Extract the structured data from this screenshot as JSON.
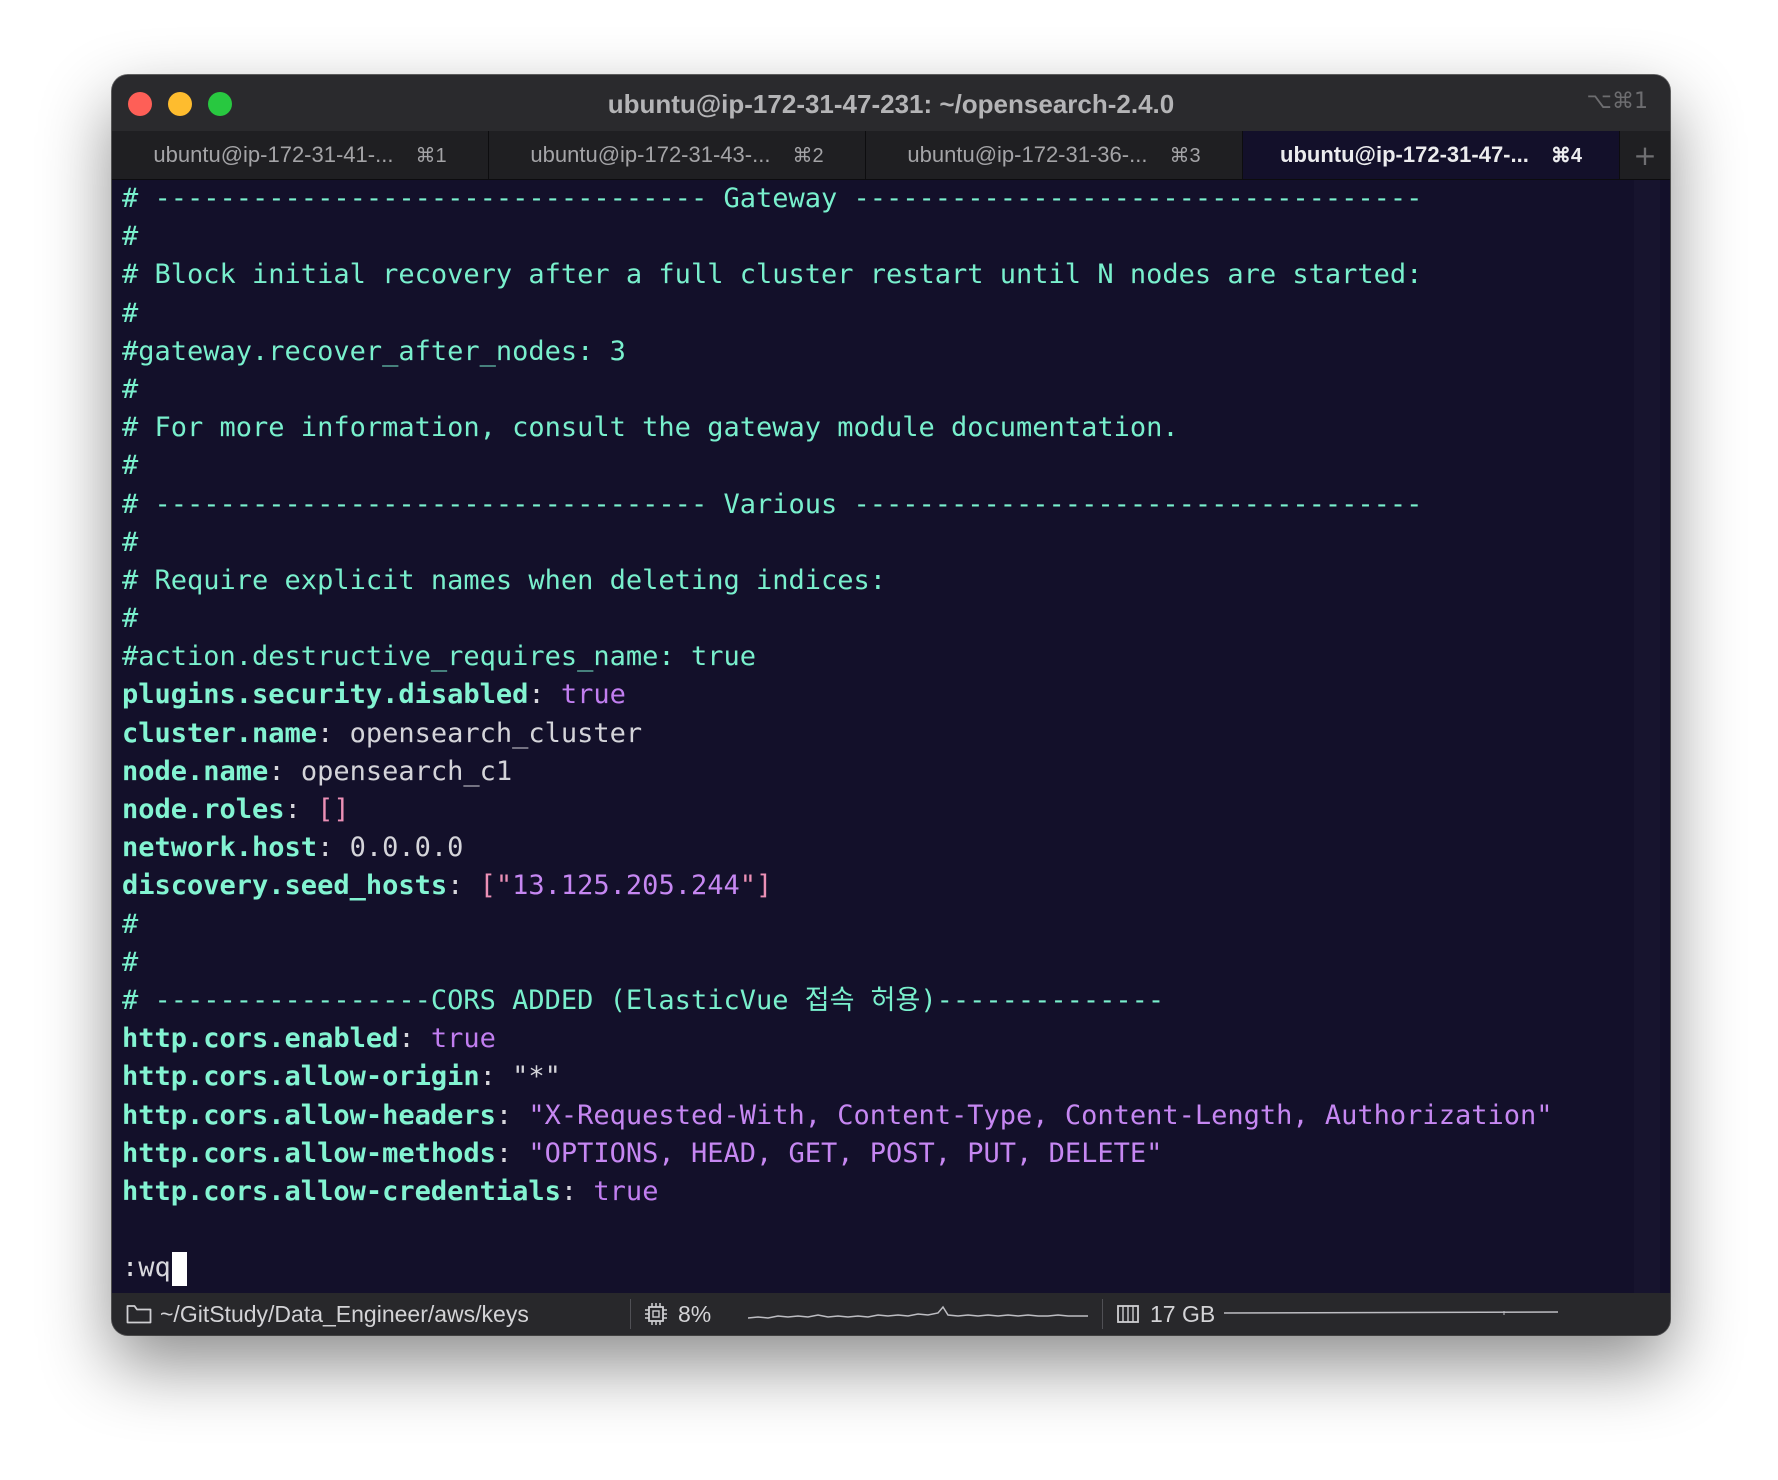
{
  "window": {
    "title": "ubuntu@ip-172-31-47-231: ~/opensearch-2.4.0",
    "shortcut": "⌥⌘1"
  },
  "tabs": [
    {
      "label": "ubuntu@ip-172-31-41-...",
      "key": "⌘1",
      "active": false
    },
    {
      "label": "ubuntu@ip-172-31-43-...",
      "key": "⌘2",
      "active": false
    },
    {
      "label": "ubuntu@ip-172-31-36-...",
      "key": "⌘3",
      "active": false
    },
    {
      "label": "ubuntu@ip-172-31-47-...",
      "key": "⌘4",
      "active": true
    }
  ],
  "tab_add_label": "+",
  "terminal": {
    "comments": {
      "gateway_header": "# ---------------------------------- Gateway -----------------------------------",
      "hash": "#",
      "block_recovery": "# Block initial recovery after a full cluster restart until N nodes are started:",
      "recover_after": "#gateway.recover_after_nodes: 3",
      "more_info": "# For more information, consult the gateway module documentation.",
      "various_header": "# ---------------------------------- Various -----------------------------------",
      "require_names": "# Require explicit names when deleting indices:",
      "destructive": "#action.destructive_requires_name: true",
      "cors_header": "# -----------------CORS ADDED (ElasticVue 접속 허용)--------------"
    },
    "config": {
      "security_key": "plugins.security.disabled",
      "security_val": "true",
      "cluster_key": "cluster.name",
      "cluster_val": "opensearch_cluster",
      "node_name_key": "node.name",
      "node_name_val": "opensearch_c1",
      "node_roles_key": "node.roles",
      "node_roles_val": "[]",
      "network_key": "network.host",
      "network_val": "0.0.0.0",
      "seed_key": "discovery.seed_hosts",
      "seed_open": "[\"",
      "seed_val": "13.125.205.244",
      "seed_close": "\"]",
      "cors_enabled_key": "http.cors.enabled",
      "cors_enabled_val": "true",
      "cors_origin_key": "http.cors.allow-origin",
      "cors_origin_val": "\"*\"",
      "cors_headers_key": "http.cors.allow-headers",
      "cors_headers_val": "\"X-Requested-With, Content-Type, Content-Length, Authorization\"",
      "cors_methods_key": "http.cors.allow-methods",
      "cors_methods_val": "\"OPTIONS, HEAD, GET, POST, PUT, DELETE\"",
      "cors_cred_key": "http.cors.allow-credentials",
      "cors_cred_val": "true"
    },
    "separator": ": ",
    "command": ":wq"
  },
  "statusbar": {
    "path": "~/GitStudy/Data_Engineer/aws/keys",
    "cpu": "8%",
    "memory": "17 GB"
  },
  "icons": {
    "folder": "folder-icon",
    "cpu": "cpu-icon",
    "memory": "memory-icon"
  }
}
